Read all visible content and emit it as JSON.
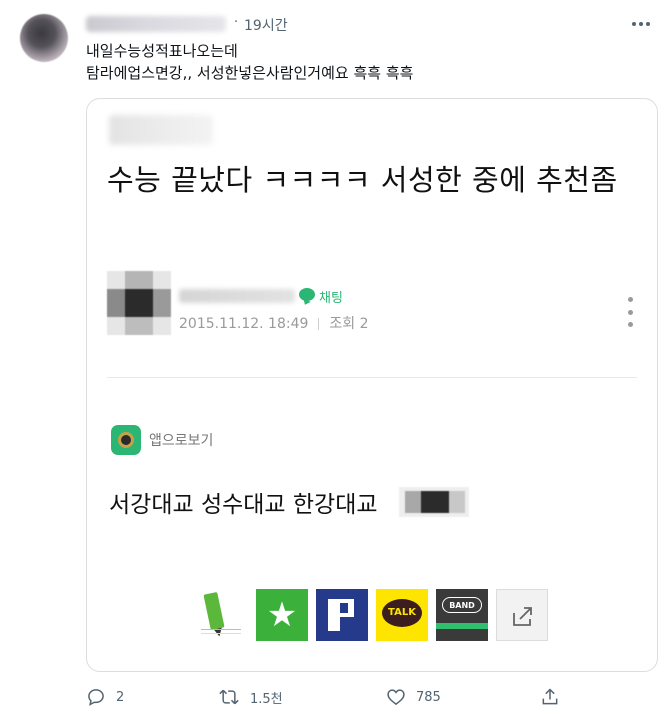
{
  "tweet": {
    "time": "19시간",
    "text_line1": "내일수능성적표나오는데",
    "text_line2": "탐라에업스면강,, 서성한넣은사람인거예요 흑흑 흑흑"
  },
  "card": {
    "post_title": "수능 끝났다 ㅋㅋㅋㅋ 서성한 중에 추천좀",
    "chat_label": "채팅",
    "date": "2015.11.12. 18:49",
    "views": "조회 2",
    "app_label": "앱으로보기",
    "body_text": "서강대교 성수대교 한강대교",
    "share_icons": [
      "naver-note-icon",
      "bookmark-star-icon",
      "postbook-icon",
      "kakaotalk-icon",
      "band-icon",
      "share-icon"
    ],
    "talk_text": "TALK",
    "band_text": "BAND"
  },
  "actions": {
    "replies": "2",
    "retweets": "1.5천",
    "likes": "785"
  },
  "colors": {
    "green": "#2bb673",
    "meta_gray": "#9a9a9a",
    "action_gray": "#536471"
  }
}
